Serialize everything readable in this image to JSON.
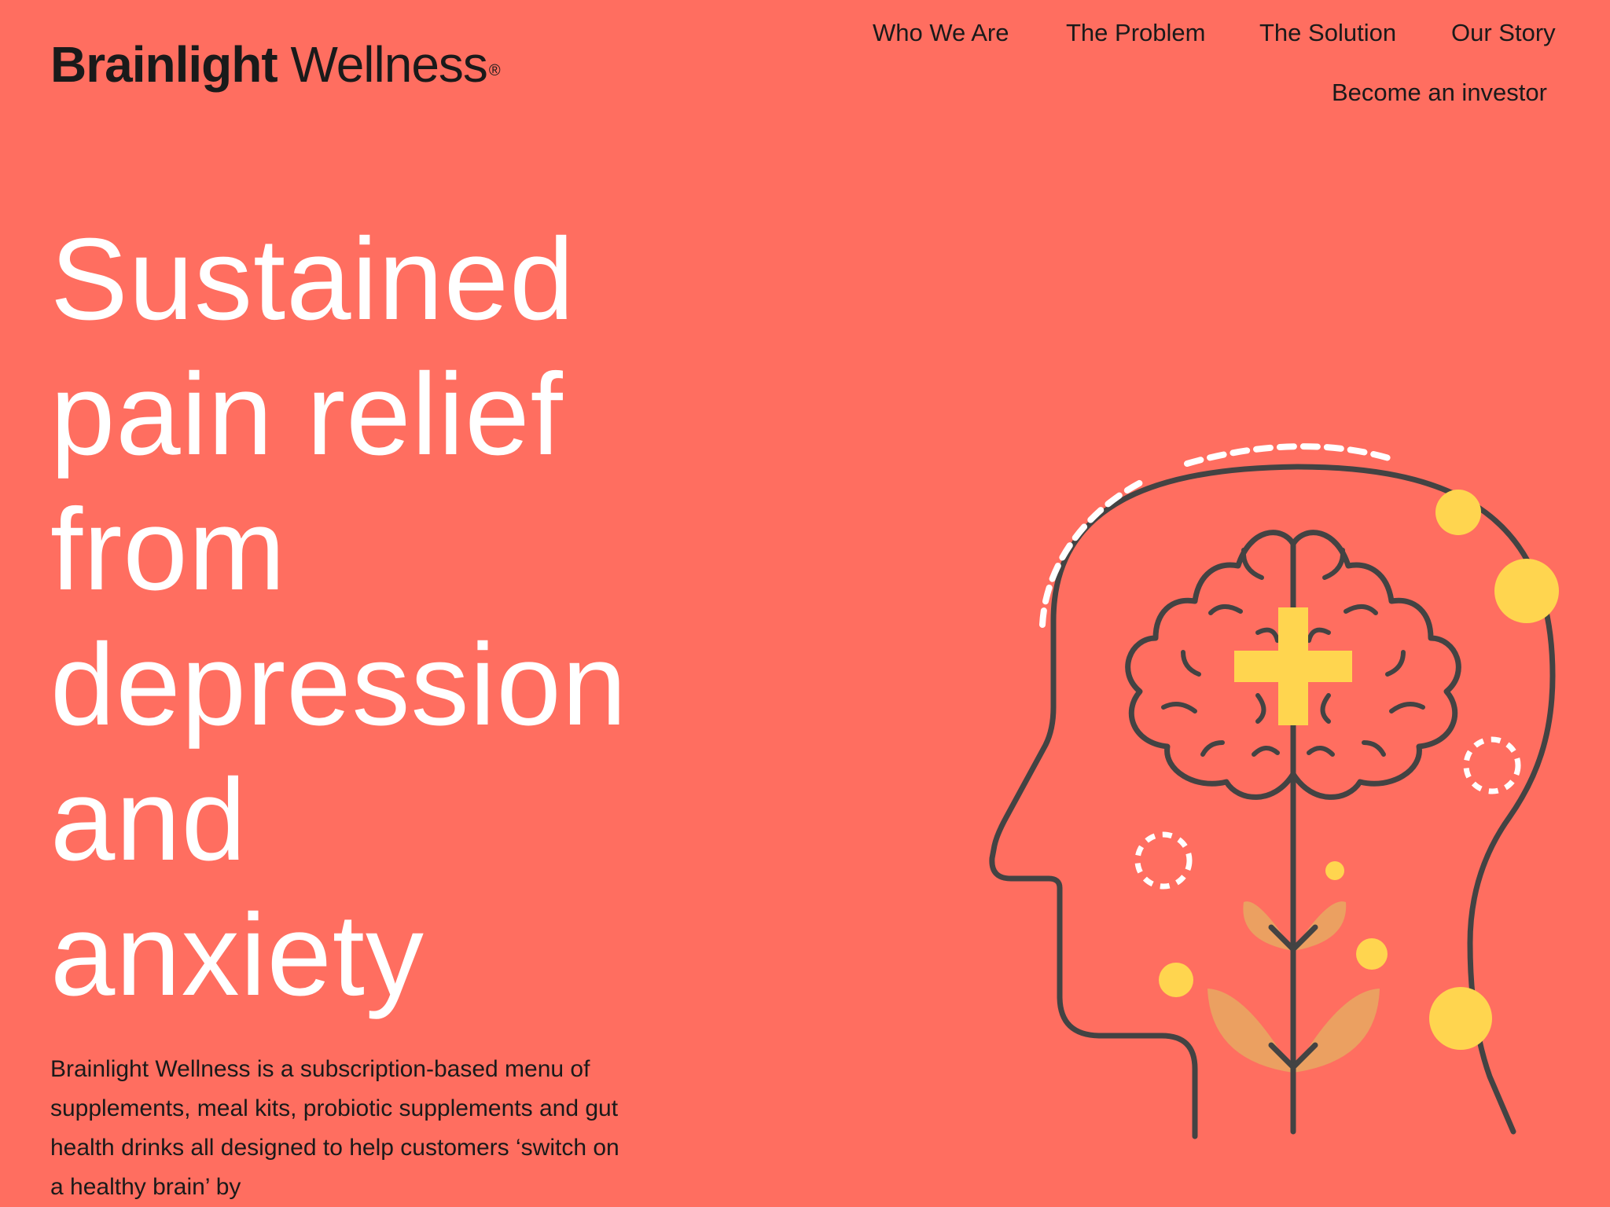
{
  "brand": {
    "name_bold": "Brainlight",
    "name_light": "Wellness",
    "registered_mark": "®"
  },
  "nav": {
    "items": [
      {
        "label": "Who We Are"
      },
      {
        "label": "The Problem"
      },
      {
        "label": "The Solution"
      },
      {
        "label": "Our Story"
      },
      {
        "label": "Become an investor"
      }
    ]
  },
  "hero": {
    "title_lines": [
      "Sustained",
      "pain relief",
      "from",
      "depression",
      "and",
      "anxiety"
    ],
    "description": "Brainlight Wellness is a subscription-based menu of supplements, meal kits, probiotic supplements and gut health drinks all designed to help customers ‘switch on a healthy brain’ by"
  },
  "colors": {
    "background": "#ff6e60",
    "text_dark": "#1a1a1a",
    "hero_text": "#ffffff",
    "illustration_line": "#434343",
    "accent_yellow": "#ffd54f",
    "leaf_orange": "#eba061"
  },
  "illustration": {
    "icon": "head-brain-plant-icon"
  }
}
